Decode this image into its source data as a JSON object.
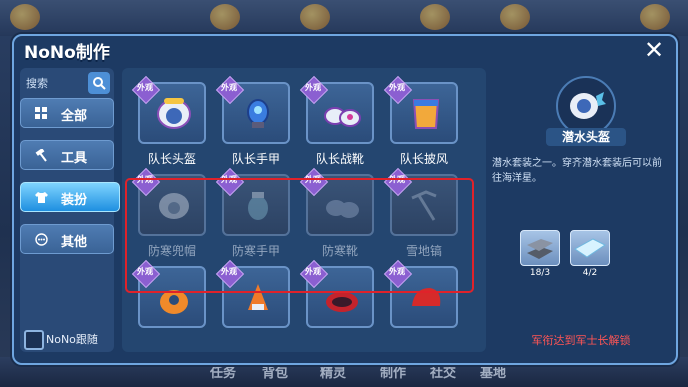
{
  "window": {
    "title": "NoNo制作",
    "close_label": "✕"
  },
  "sidebar": {
    "search_label": "搜索",
    "items": [
      {
        "label": "全部",
        "icon": "grid-icon",
        "active": false
      },
      {
        "label": "工具",
        "icon": "hammer-icon",
        "active": false
      },
      {
        "label": "装扮",
        "icon": "shirt-icon",
        "active": true
      },
      {
        "label": "其他",
        "icon": "dots-icon",
        "active": false
      }
    ],
    "follow_label": "NoNo跟随"
  },
  "grid": {
    "badge_text": "外观",
    "rows": [
      {
        "locked": false,
        "items": [
          "队长头盔",
          "队长手甲",
          "队长战靴",
          "队长披风"
        ]
      },
      {
        "locked": true,
        "items": [
          "防寒兜帽",
          "防寒手甲",
          "防寒靴",
          "雪地镐"
        ]
      },
      {
        "locked": false,
        "items": [
          "",
          "",
          "",
          ""
        ]
      }
    ]
  },
  "detail": {
    "name": "潜水头盔",
    "description": "潜水套装之一。穿齐潜水套装后可以前往海洋星。",
    "materials": [
      {
        "icon": "iron-bars-icon",
        "count": "18/3",
        "color": "#9aa6b8"
      },
      {
        "icon": "crystal-icon",
        "count": "4/2",
        "color": "#bfe7ff"
      }
    ],
    "unlock_text": "军衔达到军士长解锁",
    "unlock_color": "#ff5555"
  },
  "background_bar": {
    "items": [
      "任务",
      "背包",
      "精灵",
      "制作",
      "社交",
      "基地"
    ]
  }
}
